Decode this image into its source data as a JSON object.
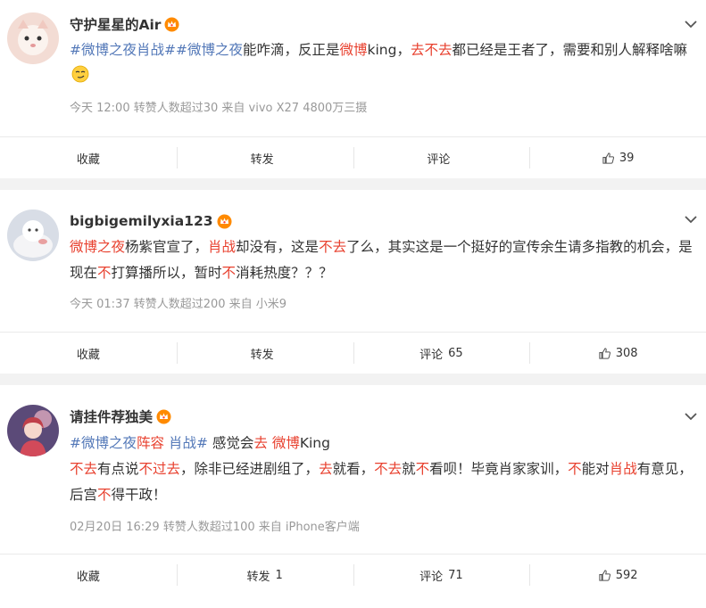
{
  "posts": [
    {
      "username": "守护星星的Air",
      "text_parts": [
        {
          "t": "#微博之夜肖战#",
          "c": "blue"
        },
        {
          "t": "#微博之夜",
          "c": "blue"
        },
        {
          "t": "能咋滴，反正是",
          "c": ""
        },
        {
          "t": "微博",
          "c": "red"
        },
        {
          "t": "king，",
          "c": ""
        },
        {
          "t": "去不去",
          "c": "red"
        },
        {
          "t": "都已经是王者了，需要和别人解释啥嘛",
          "c": ""
        }
      ],
      "meta": "今天 12:00 转赞人数超过30   来自 vivo X27 4800万三摄",
      "actions": {
        "collect": "收藏",
        "repost": "转发",
        "repost_count": "",
        "comment": "评论",
        "comment_count": "",
        "like_count": "39"
      }
    },
    {
      "username": "bigbigemilyxia123",
      "text_parts": [
        {
          "t": "微博之夜",
          "c": "red"
        },
        {
          "t": "杨紫官宣了，",
          "c": ""
        },
        {
          "t": "肖战",
          "c": "red"
        },
        {
          "t": "却没有，这是",
          "c": ""
        },
        {
          "t": "不去",
          "c": "red"
        },
        {
          "t": "了么，其实这是一个挺好的宣传余生请多指教的机会，是现在",
          "c": ""
        },
        {
          "t": "不",
          "c": "red"
        },
        {
          "t": "打算播所以，暂时",
          "c": ""
        },
        {
          "t": "不",
          "c": "red"
        },
        {
          "t": "消耗热度？？？",
          "c": ""
        }
      ],
      "meta": "今天 01:37 转赞人数超过200   来自 小米9",
      "actions": {
        "collect": "收藏",
        "repost": "转发",
        "repost_count": "",
        "comment": "评论",
        "comment_count": "65",
        "like_count": "308"
      }
    },
    {
      "username": "请挂件荐独美",
      "line1_parts": [
        {
          "t": "#微博之夜",
          "c": "blue"
        },
        {
          "t": "阵容",
          "c": "red"
        },
        {
          "t": " 肖战#",
          "c": "blue"
        },
        {
          "t": " 感觉会",
          "c": ""
        },
        {
          "t": "去",
          "c": "red"
        },
        {
          "t": " 微博",
          "c": "red"
        },
        {
          "t": "King",
          "c": ""
        }
      ],
      "text_parts": [
        {
          "t": "不去",
          "c": "red"
        },
        {
          "t": "有点说",
          "c": ""
        },
        {
          "t": "不过去",
          "c": "red"
        },
        {
          "t": "，除非已经进剧组了，",
          "c": ""
        },
        {
          "t": "去",
          "c": "red"
        },
        {
          "t": "就看，",
          "c": ""
        },
        {
          "t": "不去",
          "c": "red"
        },
        {
          "t": "就",
          "c": ""
        },
        {
          "t": "不",
          "c": "red"
        },
        {
          "t": "看呗！毕竟肖家家训，",
          "c": ""
        },
        {
          "t": "不",
          "c": "red"
        },
        {
          "t": "能对",
          "c": ""
        },
        {
          "t": "肖战",
          "c": "red"
        },
        {
          "t": "有意见，后宫",
          "c": ""
        },
        {
          "t": "不",
          "c": "red"
        },
        {
          "t": "得干政！",
          "c": ""
        }
      ],
      "meta": "02月20日 16:29 转赞人数超过100   来自 iPhone客户端",
      "actions": {
        "collect": "收藏",
        "repost": "转发",
        "repost_count": "1",
        "comment": "评论",
        "comment_count": "71",
        "like_count": "592"
      }
    }
  ],
  "icons": {
    "vip_badge": "crown-badge-icon",
    "expand": "chevron-down-icon",
    "like": "thumbs-up-icon",
    "emoji": "smirk-emoji-icon"
  },
  "colors": {
    "red": "#e8412f",
    "blue": "#5378b8",
    "meta": "#999999",
    "badge": "#ff8a00"
  }
}
